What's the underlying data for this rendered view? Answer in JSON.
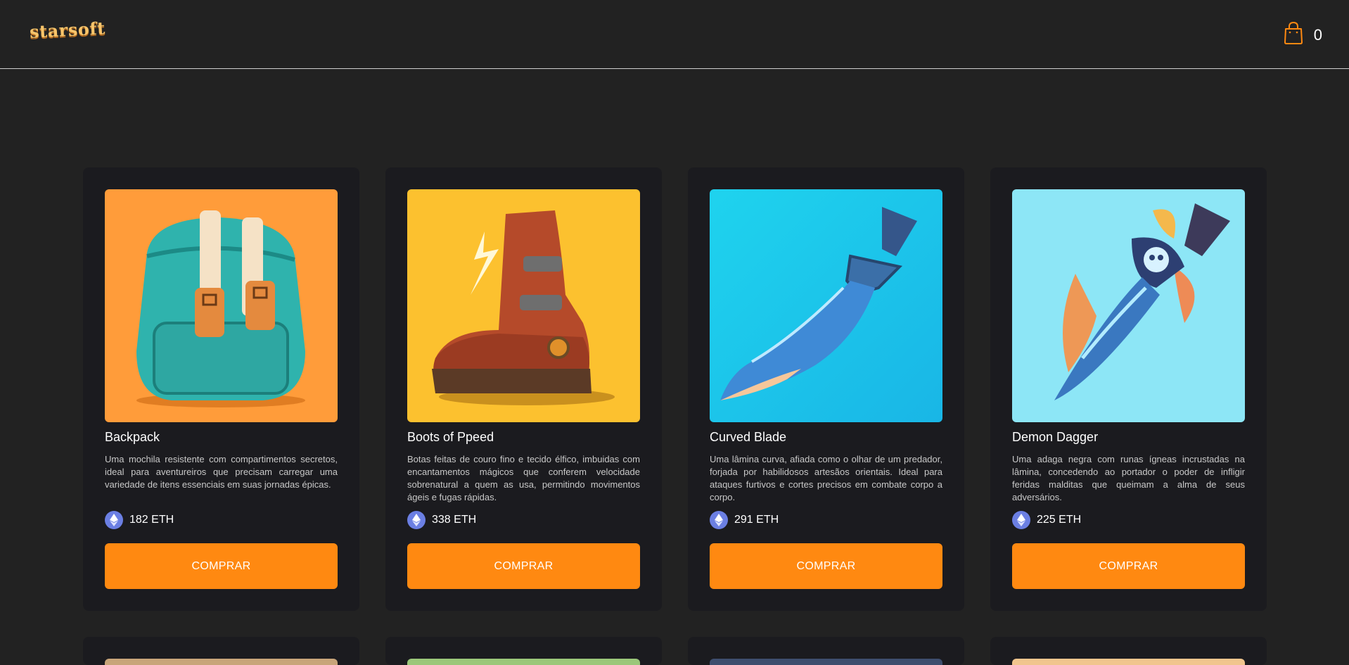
{
  "header": {
    "logo_text": "starsoft",
    "cart_icon": "shopping-bag-icon",
    "cart_count": "0"
  },
  "colors": {
    "background": "#222222",
    "card_bg": "#1b1b1f",
    "accent": "#ff8911",
    "eth": "#6b7fe3"
  },
  "products": [
    {
      "name": "Backpack",
      "description": "Uma mochila resistente com compartimentos secretos, ideal para aventureiros que precisam carregar uma variedade de itens essenciais em suas jornadas épicas.",
      "price": "182 ETH",
      "button_label": "COMPRAR",
      "image_bg": "#ff9c3a"
    },
    {
      "name": "Boots of Ppeed",
      "description": "Botas feitas de couro fino e tecido élfico, imbuidas com encantamentos mágicos que conferem velocidade sobrenatural a quem as usa, permitindo movimentos ágeis e fugas rápidas.",
      "price": "338 ETH",
      "button_label": "COMPRAR",
      "image_bg": "#fcc12f"
    },
    {
      "name": "Curved Blade",
      "description": "Uma lâmina curva, afiada como o olhar de um predador, forjada por habilidosos artesãos orientais. Ideal para ataques furtivos e cortes precisos em combate corpo a corpo.",
      "price": "291 ETH",
      "button_label": "COMPRAR",
      "image_bg": "#1fd3ee"
    },
    {
      "name": "Demon Dagger",
      "description": "Uma adaga negra com runas ígneas incrustadas na lâmina, concedendo ao portador o poder de infligir feridas malditas que queimam a alma de seus adversários.",
      "price": "225 ETH",
      "button_label": "COMPRAR",
      "image_bg": "#8de6f6"
    }
  ],
  "partial_row_thumb_colors": [
    "#c8a57a",
    "#9bc77a",
    "#3e4e6e",
    "#f1c58e"
  ]
}
